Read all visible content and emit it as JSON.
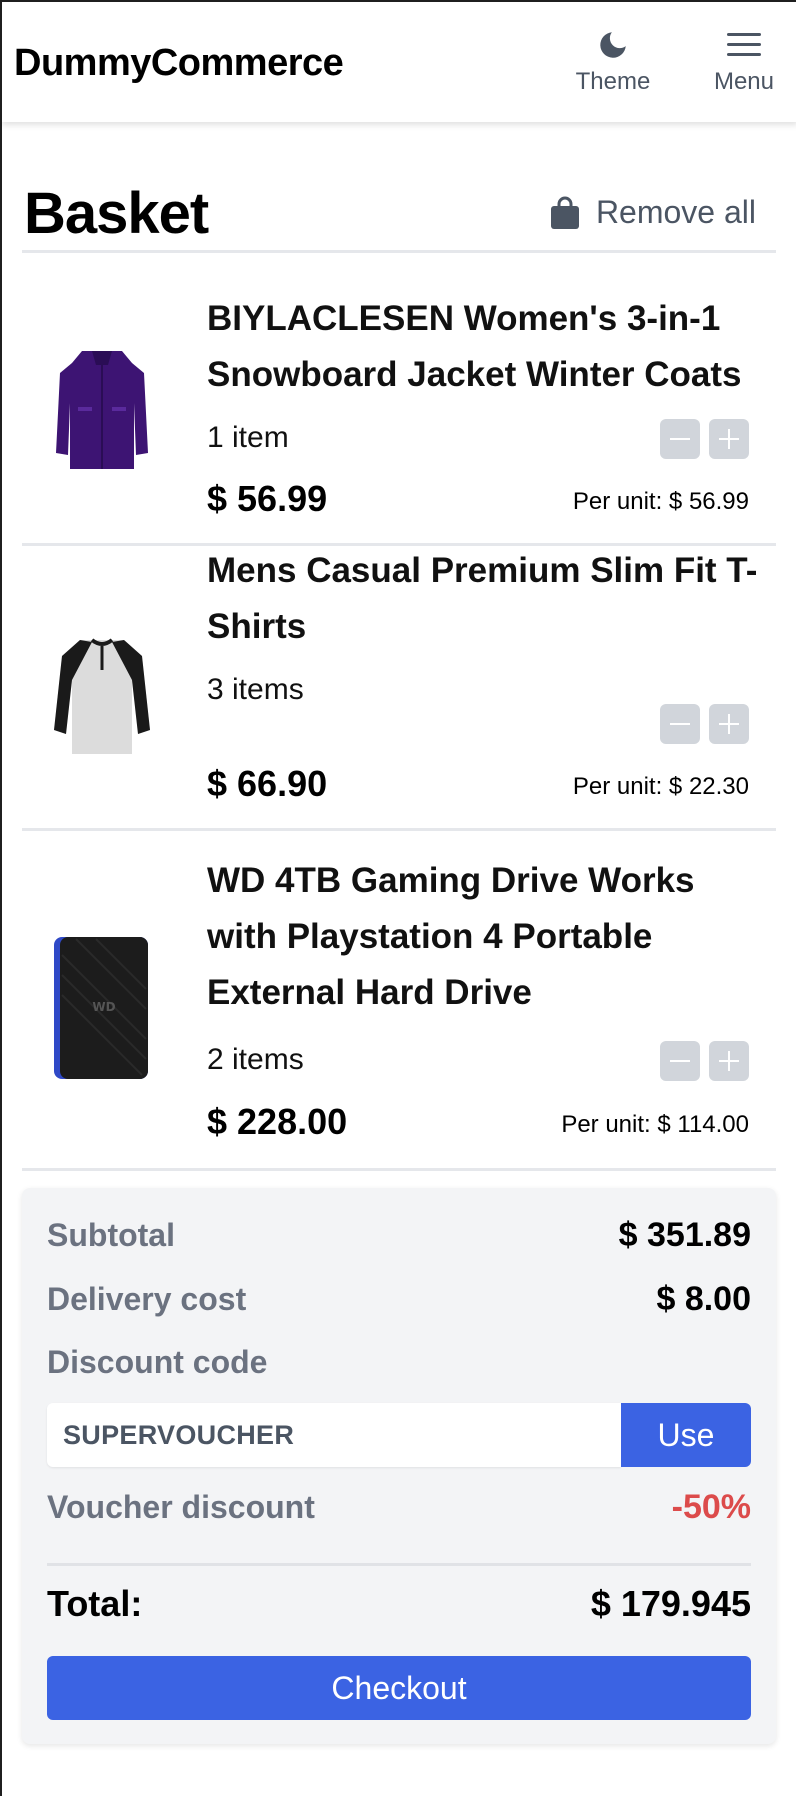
{
  "header": {
    "brand": "DummyCommerce",
    "theme_label": "Theme",
    "menu_label": "Menu"
  },
  "basket": {
    "title": "Basket",
    "remove_all_label": "Remove all"
  },
  "items": [
    {
      "title": "BIYLACLESEN Women's 3-in-1 Snowboard Jacket Winter Coats",
      "quantity": "1 item",
      "price": "$ 56.99",
      "per_unit": "Per unit: $ 56.99",
      "image": "purple-jacket-image"
    },
    {
      "title": "Mens Casual Premium Slim Fit T-Shirts",
      "quantity": "3 items",
      "price": "$ 66.90",
      "per_unit": "Per unit: $ 22.30",
      "image": "raglan-tshirt-image"
    },
    {
      "title": "WD 4TB Gaming Drive Works with Playstation 4 Portable External Hard Drive",
      "quantity": "2 items",
      "price": "$ 228.00",
      "per_unit": "Per unit: $ 114.00",
      "image": "hard-drive-image"
    }
  ],
  "summary": {
    "subtotal_label": "Subtotal",
    "subtotal_value": "$ 351.89",
    "delivery_label": "Delivery cost",
    "delivery_value": "$ 8.00",
    "discount_label": "Discount code",
    "discount_code_value": "SUPERVOUCHER",
    "use_label": "Use",
    "voucher_label": "Voucher discount",
    "voucher_value": "-50%",
    "total_label": "Total:",
    "total_value": "$ 179.945",
    "checkout_label": "Checkout"
  },
  "colors": {
    "accent": "#3b63e3",
    "muted_text": "#6b7280",
    "discount_red": "#dc4b4b",
    "card_bg": "#f3f4f6"
  },
  "icons": [
    "moon-icon",
    "hamburger-icon",
    "bag-icon",
    "minus-icon",
    "plus-icon"
  ]
}
